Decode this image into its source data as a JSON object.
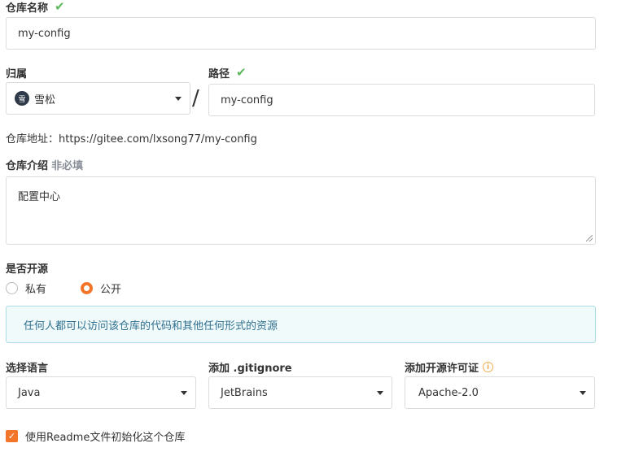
{
  "repo_name": {
    "label": "仓库名称",
    "check": "✔",
    "value": "my-config"
  },
  "owner": {
    "label": "归属",
    "avatar_text": "雪",
    "value": "雪松",
    "slash": "/"
  },
  "path": {
    "label": "路径",
    "check": "✔",
    "value": "my-config"
  },
  "repo_address": "仓库地址：https://gitee.com/lxsong77/my-config",
  "intro": {
    "label": "仓库介绍",
    "optional": "非必填",
    "value": "配置中心"
  },
  "visibility": {
    "label": "是否开源",
    "options": [
      {
        "label": "私有",
        "selected": false
      },
      {
        "label": "公开",
        "selected": true
      }
    ],
    "notice": "任何人都可以访问该仓库的代码和其他任何形式的资源"
  },
  "language": {
    "label": "选择语言",
    "value": "Java"
  },
  "gitignore": {
    "label": "添加 .gitignore",
    "value": "JetBrains"
  },
  "license": {
    "label": "添加开源许可证",
    "info_icon": "i",
    "value": "Apache-2.0"
  },
  "readme": {
    "check_glyph": "✓",
    "label": "使用Readme文件初始化这个仓库",
    "checked": true
  },
  "colors": {
    "accent": "#f3752a",
    "success": "#5cb85c",
    "notice_bg": "#f0fafb",
    "notice_border": "#a9dde3"
  }
}
